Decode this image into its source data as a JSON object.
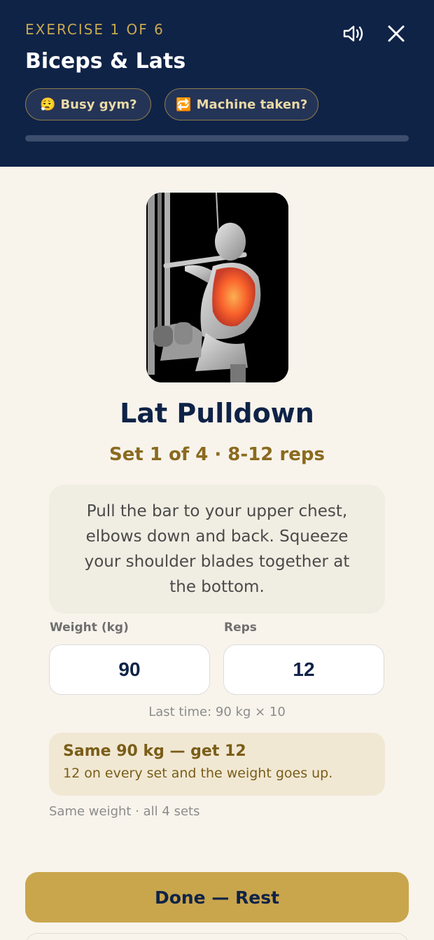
{
  "header": {
    "eyebrow": "EXERCISE 1 OF 6",
    "title": "Biceps & Lats",
    "sound_icon": "speaker-icon",
    "close_icon": "close-icon",
    "chips": [
      {
        "emoji": "😮‍💨",
        "label": "Busy gym?"
      },
      {
        "emoji": "🔁",
        "label": "Machine taken?"
      }
    ],
    "progress": 0
  },
  "exercise": {
    "name": "Lat Pulldown",
    "set_info": "Set 1 of 4 · 8-12 reps",
    "instructions": "Pull the bar to your upper chest, elbows down and back. Squeeze your shoulder blades together at the bottom."
  },
  "inputs": {
    "weight_label": "Weight (kg)",
    "weight_value": "90",
    "reps_label": "Reps",
    "reps_value": "12"
  },
  "last_time": "Last time: 90 kg × 10",
  "tip": {
    "title": "Same 90 kg — get 12",
    "body": "12 on every set and the weight goes up."
  },
  "plan_note": "Same weight · all 4 sets",
  "actions": {
    "done_label": "Done — Rest"
  },
  "colors": {
    "navy": "#0f2347",
    "gold": "#c9a64c",
    "cream": "#f8f4ec",
    "muscle": "#ff5a1f"
  }
}
